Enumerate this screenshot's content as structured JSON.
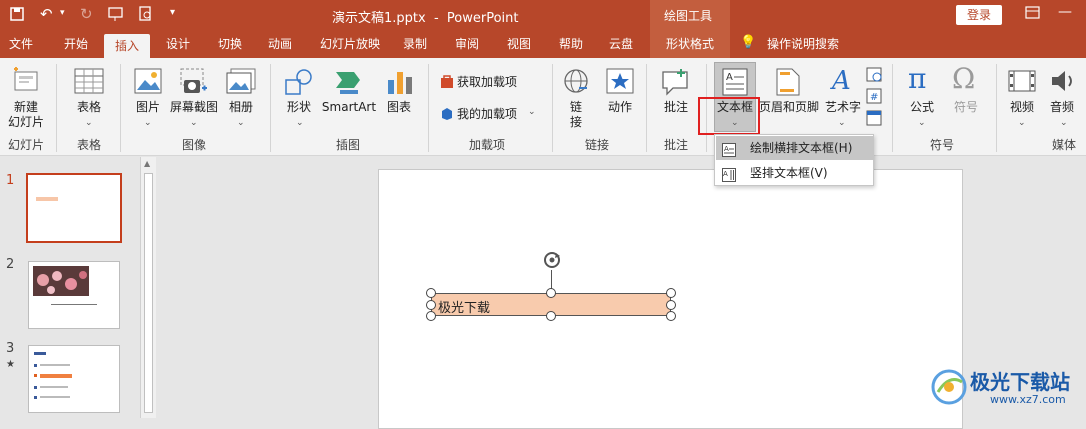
{
  "titlebar": {
    "doc_title": "演示文稿1.pptx  -  PowerPoint",
    "context_group": "绘图工具",
    "login_label": "登录",
    "bg_color": "#b7472a"
  },
  "tabs": [
    "文件",
    "开始",
    "插入",
    "设计",
    "切换",
    "动画",
    "幻灯片放映",
    "录制",
    "审阅",
    "视图",
    "帮助",
    "云盘",
    "形状格式"
  ],
  "tell_me": "操作说明搜索",
  "ribbon": {
    "new_slide": "新建\n幻灯片",
    "new_slide_l1": "新建",
    "new_slide_l2": "幻灯片",
    "group_slides": "幻灯片",
    "table": "表格",
    "group_table": "表格",
    "picture": "图片",
    "screenshot": "屏幕截图",
    "album": "相册",
    "group_image": "图像",
    "shapes": "形状",
    "smartart": "SmartArt",
    "chart": "图表",
    "group_illustration": "插图",
    "get_addins": "获取加载项",
    "my_addins": "我的加载项",
    "group_addins": "加载项",
    "link_l1": "链",
    "link_l2": "接",
    "action": "动作",
    "group_links": "链接",
    "comment": "批注",
    "group_comments": "批注",
    "textbox": "文本框",
    "header_footer": "页眉和页脚",
    "wordart": "艺术字",
    "equation": "公式",
    "symbol": "符号",
    "group_symbols": "符号",
    "video": "视频",
    "audio": "音频",
    "group_media": "媒体"
  },
  "dropdown": {
    "item1": "绘制横排文本框(H)",
    "item2": "竖排文本框(V)"
  },
  "thumbnails": {
    "n1": "1",
    "n2": "2",
    "n3": "3",
    "star": "★"
  },
  "slide": {
    "textbox_text": "极光下载"
  },
  "watermark": {
    "text": "极光下载站",
    "url": "www.xz7.com"
  }
}
